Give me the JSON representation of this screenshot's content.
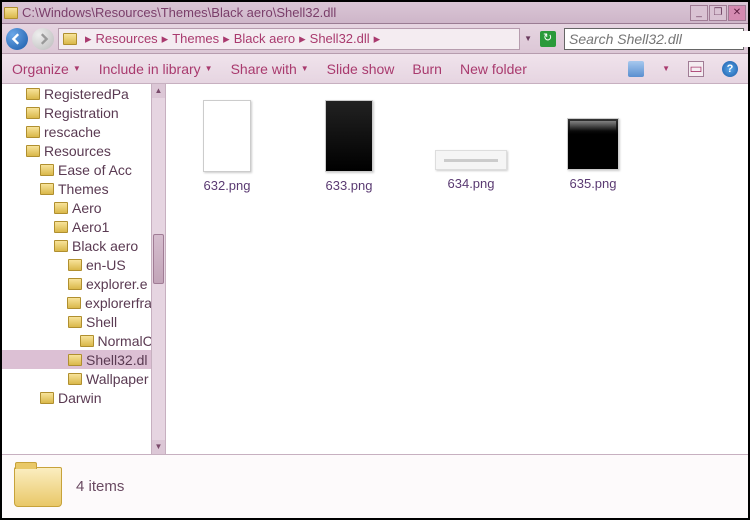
{
  "window": {
    "title": "C:\\Windows\\Resources\\Themes\\Black aero\\Shell32.dll"
  },
  "breadcrumb": {
    "items": [
      "Resources",
      "Themes",
      "Black aero",
      "Shell32.dll"
    ]
  },
  "search": {
    "placeholder": "Search Shell32.dll"
  },
  "toolbar": {
    "organize": "Organize",
    "include": "Include in library",
    "share": "Share with",
    "slideshow": "Slide show",
    "burn": "Burn",
    "newfolder": "New folder"
  },
  "tree": {
    "nodes": [
      {
        "label": "RegisteredPa",
        "depth": 1,
        "sel": false
      },
      {
        "label": "Registration",
        "depth": 1,
        "sel": false
      },
      {
        "label": "rescache",
        "depth": 1,
        "sel": false
      },
      {
        "label": "Resources",
        "depth": 1,
        "sel": false
      },
      {
        "label": "Ease of Acc",
        "depth": 2,
        "sel": false
      },
      {
        "label": "Themes",
        "depth": 2,
        "sel": false
      },
      {
        "label": "Aero",
        "depth": 3,
        "sel": false
      },
      {
        "label": "Aero1",
        "depth": 3,
        "sel": false
      },
      {
        "label": "Black aero",
        "depth": 3,
        "sel": false
      },
      {
        "label": "en-US",
        "depth": 4,
        "sel": false
      },
      {
        "label": "explorer.e",
        "depth": 4,
        "sel": false
      },
      {
        "label": "explorerfra",
        "depth": 4,
        "sel": false
      },
      {
        "label": "Shell",
        "depth": 4,
        "sel": false
      },
      {
        "label": "NormalC",
        "depth": 5,
        "sel": false
      },
      {
        "label": "Shell32.dl",
        "depth": 4,
        "sel": true
      },
      {
        "label": "Wallpaper",
        "depth": 4,
        "sel": false
      },
      {
        "label": "Darwin",
        "depth": 2,
        "sel": false
      }
    ]
  },
  "files": [
    {
      "name": "632.png",
      "variant": "white"
    },
    {
      "name": "633.png",
      "variant": "black"
    },
    {
      "name": "634.png",
      "variant": "wide"
    },
    {
      "name": "635.png",
      "variant": "sq"
    }
  ],
  "status": {
    "text": "4 items"
  }
}
